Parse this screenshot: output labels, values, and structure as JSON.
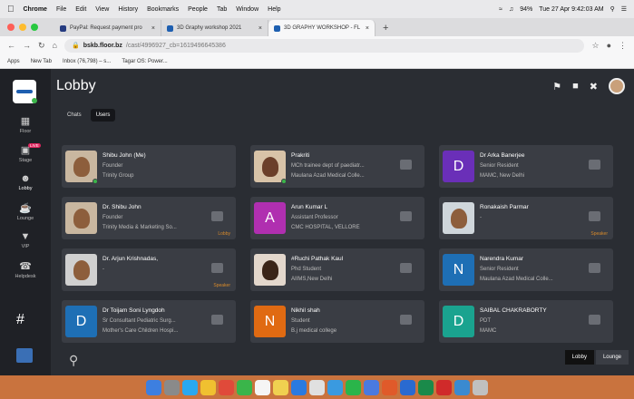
{
  "mac_menubar": {
    "app": "Chrome",
    "items": [
      "File",
      "Edit",
      "View",
      "History",
      "Bookmarks",
      "People",
      "Tab",
      "Window",
      "Help"
    ],
    "battery": "94%",
    "clock": "Tue 27 Apr  9:42:03 AM"
  },
  "browser": {
    "tabs": [
      {
        "label": "PayPal: Request payment pro",
        "active": false,
        "color": "#253b80"
      },
      {
        "label": "3D Graphy workshop 2021",
        "active": false,
        "color": "#1e5fb0"
      },
      {
        "label": "3D GRAPHY WORKSHOP - FL",
        "active": true,
        "color": "#1e5fb0"
      }
    ],
    "new_tab": "+",
    "url_host": "bskb.floor.bz",
    "url_rest": "/cast/4996927_cb=1619496645386",
    "bookmarks": [
      "Apps",
      "New Tab",
      "Inbox (76,798) – s...",
      "Tagar OS: Power..."
    ]
  },
  "sidebar": {
    "items": [
      {
        "label": "Floor",
        "icon": "map-icon"
      },
      {
        "label": "Stage",
        "icon": "stage-icon",
        "badge": "LIVE"
      },
      {
        "label": "Lobby",
        "icon": "people-icon",
        "active": true
      },
      {
        "label": "Lounge",
        "icon": "coffee-icon"
      },
      {
        "label": "VIP",
        "icon": "mic-icon"
      },
      {
        "label": "Helpdesk",
        "icon": "helpdesk-icon"
      }
    ],
    "hash": "#"
  },
  "header": {
    "title": "Lobby"
  },
  "tabs": [
    {
      "label": "Chats",
      "active": false
    },
    {
      "label": "Users",
      "active": true
    }
  ],
  "users": [
    {
      "name": "Shibu John (Me)",
      "line2": "Founder",
      "line3": "Trinity Group",
      "avatar": "photo",
      "online": true,
      "location": ""
    },
    {
      "name": "Prakriti",
      "line2": "MCh trainee dept of paediatr...",
      "line3": "Maulana Azad Medical Colle...",
      "avatar": "photo",
      "online": true,
      "location": ""
    },
    {
      "name": "Dr Arka Banerjee",
      "line2": "Senior Resident",
      "line3": "MAMC, New Delhi",
      "avatar": "letter",
      "letter": "D",
      "color": "#6a2fb8",
      "online": false,
      "location": ""
    },
    {
      "name": "Dr. Shibu John",
      "line2": "Founder",
      "line3": "Trinity Media & Marketing So...",
      "avatar": "photo",
      "online": false,
      "location": "Lobby"
    },
    {
      "name": "Arun Kumar L",
      "line2": "Assistant Professor",
      "line3": "CMC HOSPITAL, VELLORE",
      "avatar": "letter",
      "letter": "A",
      "color": "#b02fb0",
      "online": false,
      "location": ""
    },
    {
      "name": "Ronakaish Parmar",
      "line2": "-",
      "line3": "",
      "avatar": "photo",
      "online": false,
      "location": "Speaker"
    },
    {
      "name": "Dr. Arjun Krishnadas,",
      "line2": "-",
      "line3": "",
      "avatar": "photo",
      "online": false,
      "location": "Speaker"
    },
    {
      "name": "#Ruchi Pathak Kaul",
      "line2": "Phd Student",
      "line3": "AIIMS,New Delhi",
      "avatar": "photo",
      "online": false,
      "location": ""
    },
    {
      "name": "Narendra Kumar",
      "line2": "Senior Resident",
      "line3": "Maulana Azad Medical Colle...",
      "avatar": "letter",
      "letter": "N",
      "color": "#1e6fb5",
      "online": false,
      "location": ""
    },
    {
      "name": "Dr Toijam Soni Lyngdoh",
      "line2": "Sr Consultant Pediatric Surg...",
      "line3": "Mother's Care Children Hospi...",
      "avatar": "letter",
      "letter": "D",
      "color": "#1e6fb5",
      "online": false,
      "location": ""
    },
    {
      "name": "Nikhil shah",
      "line2": "Student",
      "line3": "B.j medical college",
      "avatar": "letter",
      "letter": "N",
      "color": "#e06a12",
      "online": false,
      "location": ""
    },
    {
      "name": "SAIBAL CHAKRABORTY",
      "line2": "PDT",
      "line3": "MAMC",
      "avatar": "letter",
      "letter": "D",
      "color": "#1aa38f",
      "online": false,
      "location": ""
    }
  ],
  "bottom_tabs": [
    {
      "label": "Lobby",
      "active": true
    },
    {
      "label": "Lounge",
      "active": false
    }
  ],
  "colors": {
    "bg": "#2a2d33",
    "sidebar": "#1f2126",
    "card": "#3a3d44",
    "online": "#3bb54a",
    "speaker": "#d88a2a"
  }
}
